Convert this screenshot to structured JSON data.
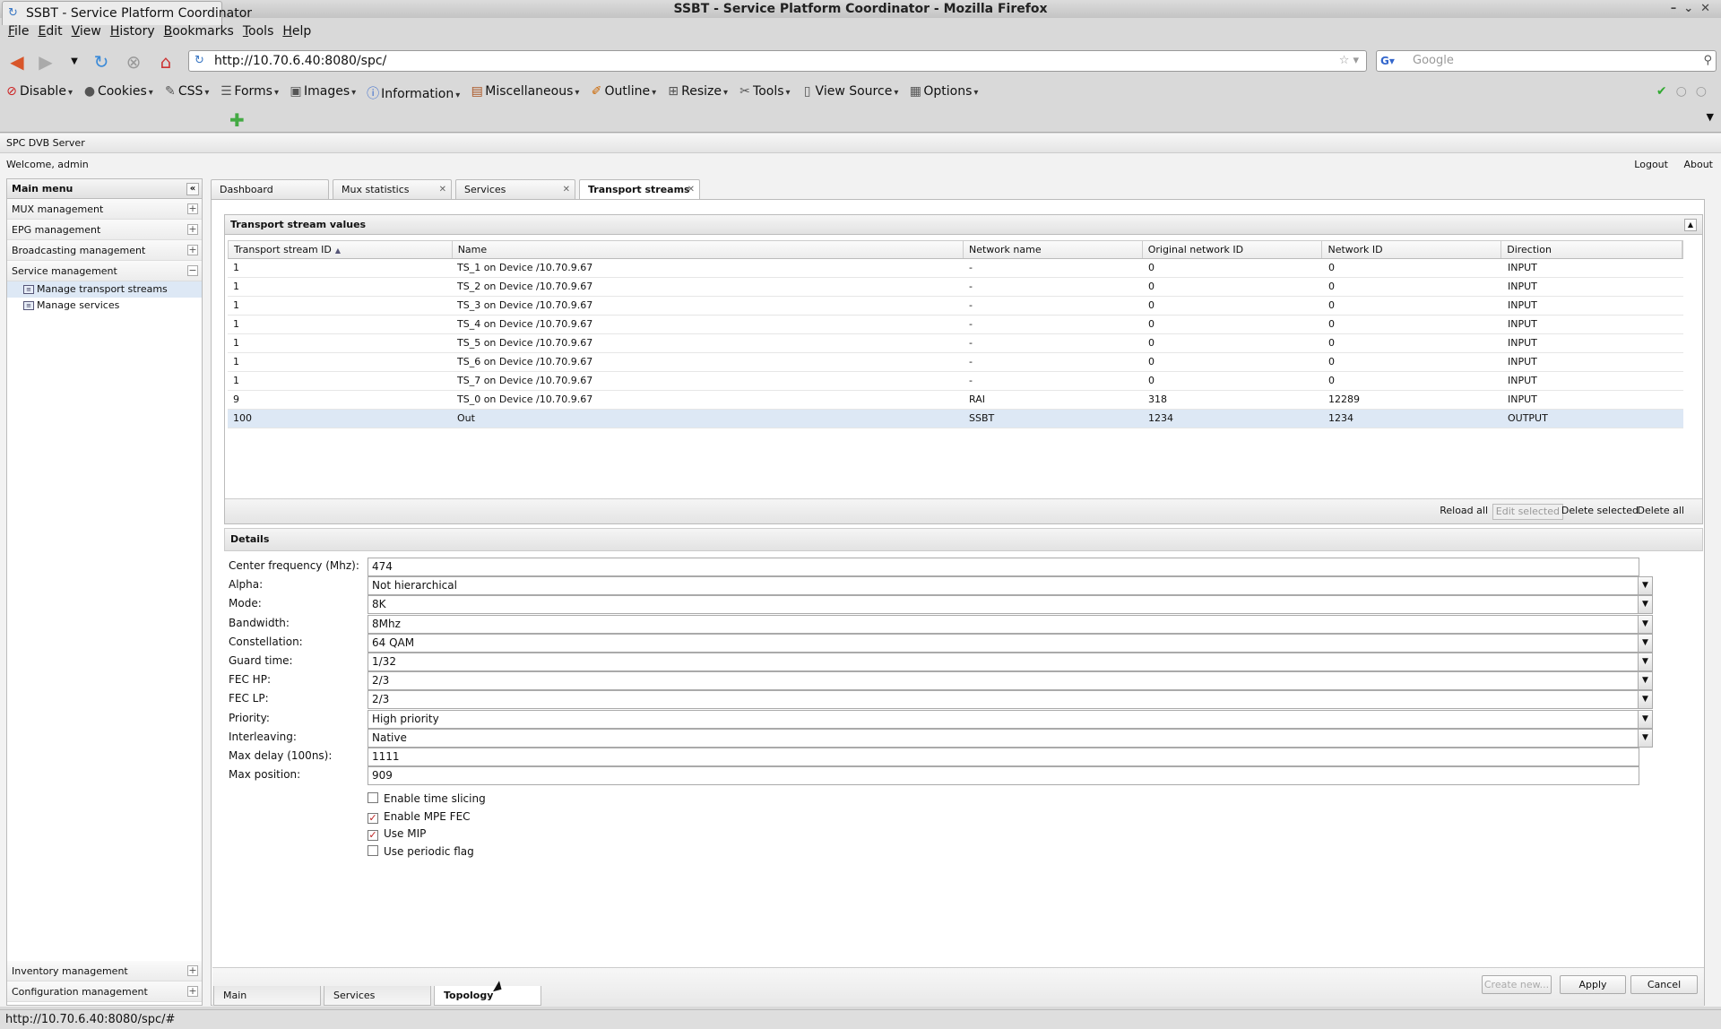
{
  "window": {
    "title": "SSBT - Service Platform Coordinator - Mozilla Firefox"
  },
  "menubar": [
    "File",
    "Edit",
    "View",
    "History",
    "Bookmarks",
    "Tools",
    "Help"
  ],
  "navbar": {
    "url": "http://10.70.6.40:8080/spc/",
    "search_placeholder": "Google"
  },
  "devtoolbar": [
    {
      "label": "Disable",
      "icon": "disable-icon"
    },
    {
      "label": "Cookies",
      "icon": "cookies-icon"
    },
    {
      "label": "CSS",
      "icon": "css-icon"
    },
    {
      "label": "Forms",
      "icon": "forms-icon"
    },
    {
      "label": "Images",
      "icon": "images-icon"
    },
    {
      "label": "Information",
      "icon": "information-icon"
    },
    {
      "label": "Miscellaneous",
      "icon": "miscellaneous-icon"
    },
    {
      "label": "Outline",
      "icon": "outline-icon"
    },
    {
      "label": "Resize",
      "icon": "resize-icon"
    },
    {
      "label": "Tools",
      "icon": "tools-icon"
    },
    {
      "label": "View Source",
      "icon": "view-source-icon"
    },
    {
      "label": "Options",
      "icon": "options-icon"
    }
  ],
  "browser_tab": {
    "title": "SSBT - Service Platform Coordinator"
  },
  "app": {
    "name": "SPC DVB Server",
    "welcome": "Welcome, admin",
    "logout": "Logout",
    "about": "About"
  },
  "sidebar": {
    "title": "Main menu",
    "groups": [
      {
        "label": "MUX management"
      },
      {
        "label": "EPG management"
      },
      {
        "label": "Broadcasting management"
      },
      {
        "label": "Service management"
      }
    ],
    "subitems": [
      {
        "label": "Manage transport streams"
      },
      {
        "label": "Manage services"
      }
    ],
    "bottom_groups": [
      {
        "label": "Inventory management"
      },
      {
        "label": "Configuration management"
      }
    ]
  },
  "main_tabs": [
    {
      "label": "Dashboard"
    },
    {
      "label": "Mux statistics"
    },
    {
      "label": "Services"
    },
    {
      "label": "Transport streams"
    }
  ],
  "ts_panel": {
    "title": "Transport stream values",
    "columns": [
      "Transport stream ID",
      "Name",
      "Network name",
      "Original network ID",
      "Network ID",
      "Direction"
    ],
    "rows": [
      [
        "1",
        "TS_1 on Device /10.70.9.67",
        "-",
        "0",
        "0",
        "INPUT"
      ],
      [
        "1",
        "TS_2 on Device /10.70.9.67",
        "-",
        "0",
        "0",
        "INPUT"
      ],
      [
        "1",
        "TS_3 on Device /10.70.9.67",
        "-",
        "0",
        "0",
        "INPUT"
      ],
      [
        "1",
        "TS_4 on Device /10.70.9.67",
        "-",
        "0",
        "0",
        "INPUT"
      ],
      [
        "1",
        "TS_5 on Device /10.70.9.67",
        "-",
        "0",
        "0",
        "INPUT"
      ],
      [
        "1",
        "TS_6 on Device /10.70.9.67",
        "-",
        "0",
        "0",
        "INPUT"
      ],
      [
        "1",
        "TS_7 on Device /10.70.9.67",
        "-",
        "0",
        "0",
        "INPUT"
      ],
      [
        "9",
        "TS_0 on Device /10.70.9.67",
        "RAI",
        "318",
        "12289",
        "INPUT"
      ],
      [
        "100",
        "Out",
        "SSBT",
        "1234",
        "1234",
        "OUTPUT"
      ]
    ],
    "buttons": {
      "reload_all": "Reload all",
      "edit_selected": "Edit selected",
      "delete_selected": "Delete selected",
      "delete_all": "Delete all"
    }
  },
  "details": {
    "title": "Details",
    "fields": [
      {
        "label": "Center frequency (Mhz):",
        "value": "474",
        "type": "input"
      },
      {
        "label": "Alpha:",
        "value": "Not hierarchical",
        "type": "select"
      },
      {
        "label": "Mode:",
        "value": "8K",
        "type": "select"
      },
      {
        "label": "Bandwidth:",
        "value": "8Mhz",
        "type": "select"
      },
      {
        "label": "Constellation:",
        "value": "64 QAM",
        "type": "select"
      },
      {
        "label": "Guard time:",
        "value": "1/32",
        "type": "select"
      },
      {
        "label": "FEC HP:",
        "value": "2/3",
        "type": "select"
      },
      {
        "label": "FEC LP:",
        "value": "2/3",
        "type": "select"
      },
      {
        "label": "Priority:",
        "value": "High priority",
        "type": "select"
      },
      {
        "label": "Interleaving:",
        "value": "Native",
        "type": "select"
      },
      {
        "label": "Max delay (100ns):",
        "value": "1111",
        "type": "input"
      },
      {
        "label": "Max position:",
        "value": "909",
        "type": "input"
      }
    ],
    "checkboxes": [
      {
        "label": "Enable time slicing",
        "checked": false
      },
      {
        "label": "Enable MPE FEC",
        "checked": true
      },
      {
        "label": "Use MIP",
        "checked": true
      },
      {
        "label": "Use periodic flag",
        "checked": false
      }
    ],
    "buttons": {
      "create_new": "Create new...",
      "apply": "Apply",
      "cancel": "Cancel"
    },
    "sub_tabs": [
      {
        "label": "Main"
      },
      {
        "label": "Services"
      },
      {
        "label": "Topology"
      }
    ]
  },
  "statusbar": {
    "text": "http://10.70.6.40:8080/spc/#"
  }
}
